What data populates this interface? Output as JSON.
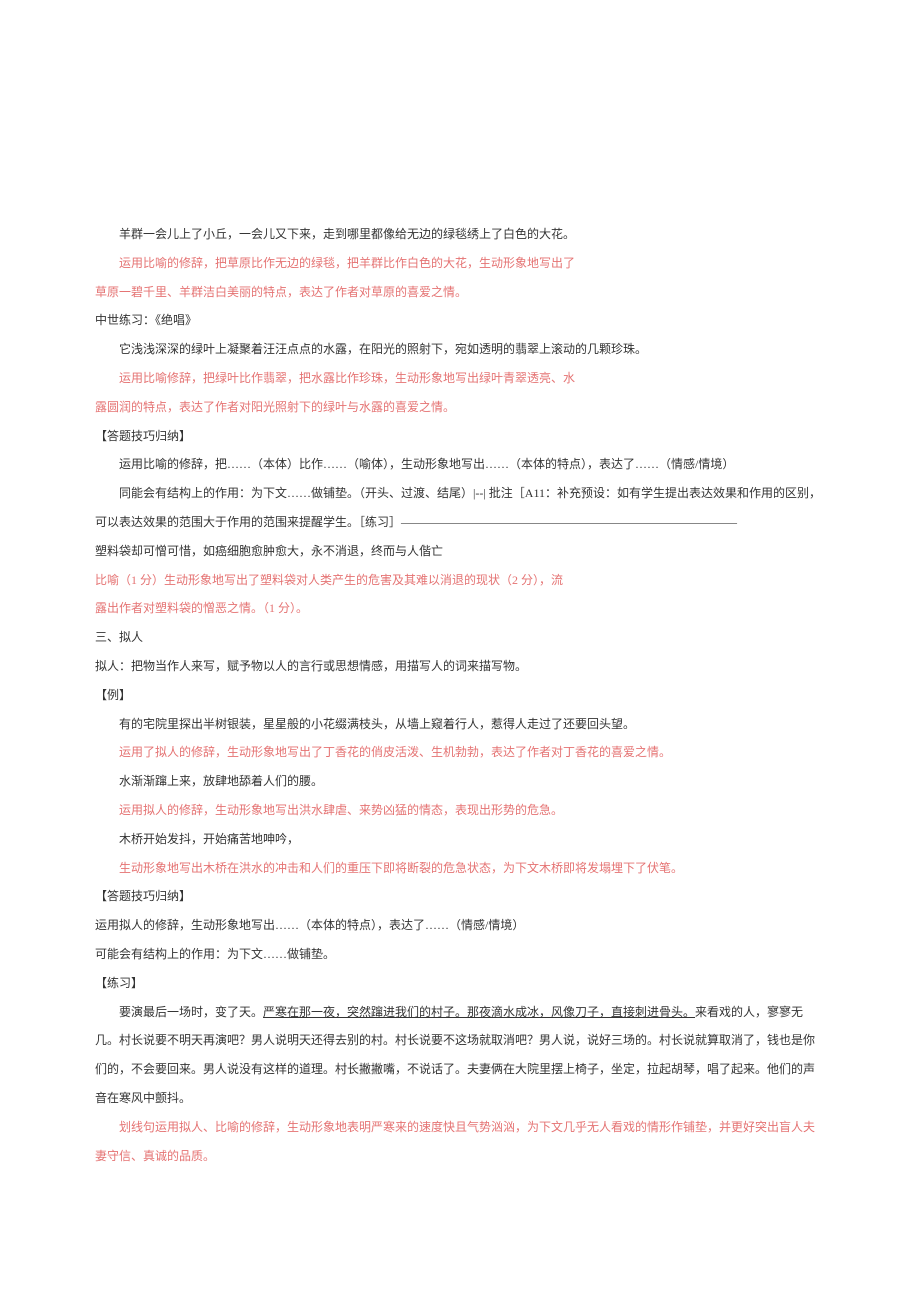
{
  "p01": "羊群一会儿上了小丘，一会儿又下来，走到哪里都像给无边的绿毯绣上了白色的大花。",
  "p02": "运用比喻的修辞，把草原比作无边的绿毯，把羊群比作白色的大花，生动形象地写出了",
  "p03": "草原一碧千里、羊群洁白美丽的特点，表达了作者对草原的喜爱之情。",
  "p04": "中世练习：《绝唱》",
  "p05": "它浅浅深深的绿叶上凝聚着汪汪点点的水露，在阳光的照射下，宛如透明的翡翠上滚动的几颗珍珠。",
  "p06": "运用比喻修辞，把绿叶比作翡翠，把水露比作珍珠，生动形象地写出绿叶青翠透亮、水",
  "p07": "露圆润的特点，表达了作者对阳光照射下的绿叶与水露的喜爱之情。",
  "p08": "【答题技巧归纳】",
  "p09": "运用比喻的修辞，把……（本体）比作……（喻体），生动形象地写出……（本体的特点），表达了……（情感/情境）",
  "p10": "同能会有结构上的作用：为下文……做铺垫。（开头、过渡、结尾）|--| 批注［A11：补充预设：如有学生提出表达效果和作用的区别，可以表达效果的范围大于作用的范围来提醒学生。［练习］",
  "p10_dash": "————————————————————————————",
  "p11": "塑料袋却可憎可惜，如癌细胞愈肿愈大，永不消退，终而与人偕亡",
  "p12": "比喻（1 分）生动形象地写出了塑料袋对人类产生的危害及其难以消退的现状（2 分），流",
  "p13": "露出作者对塑料袋的憎恶之情。（1 分）。",
  "p14": "三、拟人",
  "p15": "拟人：把物当作人来写，赋予物以人的言行或思想情感，用描写人的词来描写物。",
  "p16": "【例】",
  "p17": "有的宅院里探出半树银装，星星般的小花缀满枝头，从墙上窥着行人，惹得人走过了还要回头望。",
  "p18": "运用了拟人的修辞，生动形象地写出了丁香花的俏皮活泼、生机勃勃，表达了作者对丁香花的喜爱之情。",
  "p19": "水渐渐蹿上来，放肆地舔着人们的腰。",
  "p20": "运用拟人的修辞，生动形象地写出洪水肆虐、来势凶猛的情态，表现出形势的危急。",
  "p21": "木桥开始发抖，开始痛苦地呻吟，",
  "p22": "生动形象地写出木桥在洪水的冲击和人们的重压下即将断裂的危急状态，为下文木桥即将发塌埋下了伏笔。",
  "p23": "【答题技巧归纳】",
  "p24": "运用拟人的修辞，生动形象地写出……（本体的特点），表达了……（情感/情境）",
  "p25": "可能会有结构上的作用：为下文……做铺垫。",
  "p26": "【练习】",
  "p27a": "要演最后一场时，变了天。",
  "p27b": "严寒在那一夜，突然蹿进我们的村子。那夜滴水成冰，风像刀子，直接刺进骨头。",
  "p27c": "来看戏的人，寥寥无几。村长说要不明天再演吧？男人说明天还得去别的村。村长说要不这场就取消吧？男人说，说好三场的。村长说就算取消了，钱也是你们的，不会要回来。男人说没有这样的道理。村长撇撇嘴，不说话了。夫妻俩在大院里摆上椅子，坐定，拉起胡琴，唱了起来。他们的声音在寒风中颤抖。",
  "p28": "划线句运用拟人、比喻的修辞，生动形象地表明严寒来的速度快且气势汹汹，为下文几乎无人看戏的情形作铺垫，并更好突出盲人夫妻守信、真诚的品质。"
}
